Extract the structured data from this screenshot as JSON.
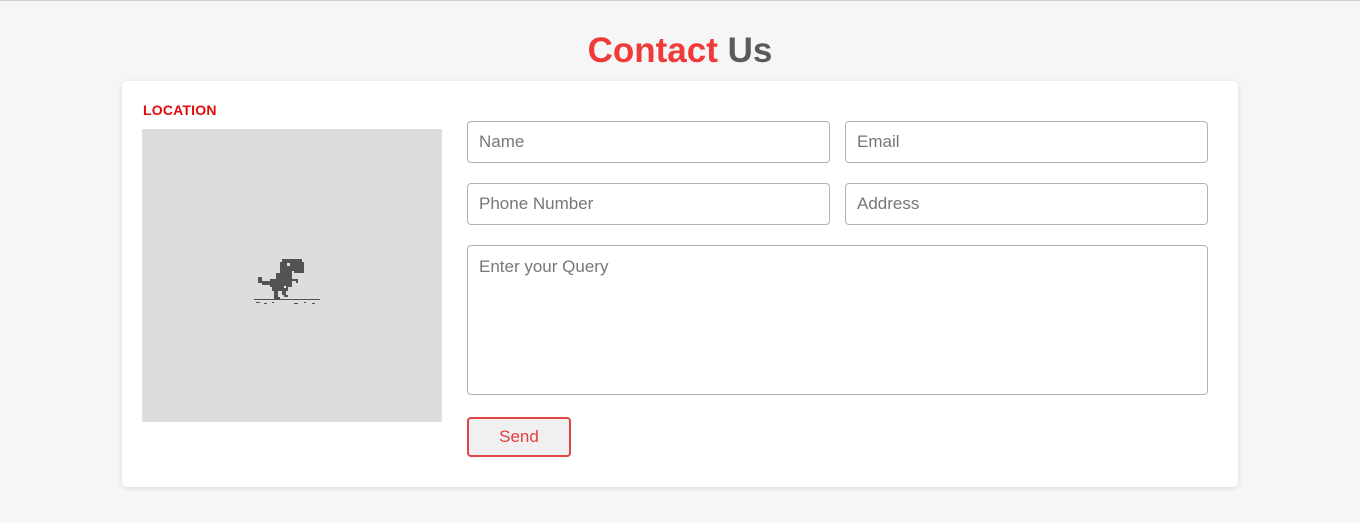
{
  "header": {
    "title_accent": "Contact",
    "title_rest": "Us"
  },
  "location": {
    "label": "LOCATION",
    "map_state_icon": "dino-offline-icon"
  },
  "form": {
    "name_placeholder": "Name",
    "email_placeholder": "Email",
    "phone_placeholder": "Phone Number",
    "address_placeholder": "Address",
    "query_placeholder": "Enter your Query",
    "send_label": "Send"
  },
  "colors": {
    "accent": "#f03a3a",
    "title_gray": "#5a5a5a",
    "location_red": "#e00b0b",
    "page_background": "#f6f6f6",
    "card_background": "#ffffff",
    "map_placeholder": "#dddddd"
  }
}
